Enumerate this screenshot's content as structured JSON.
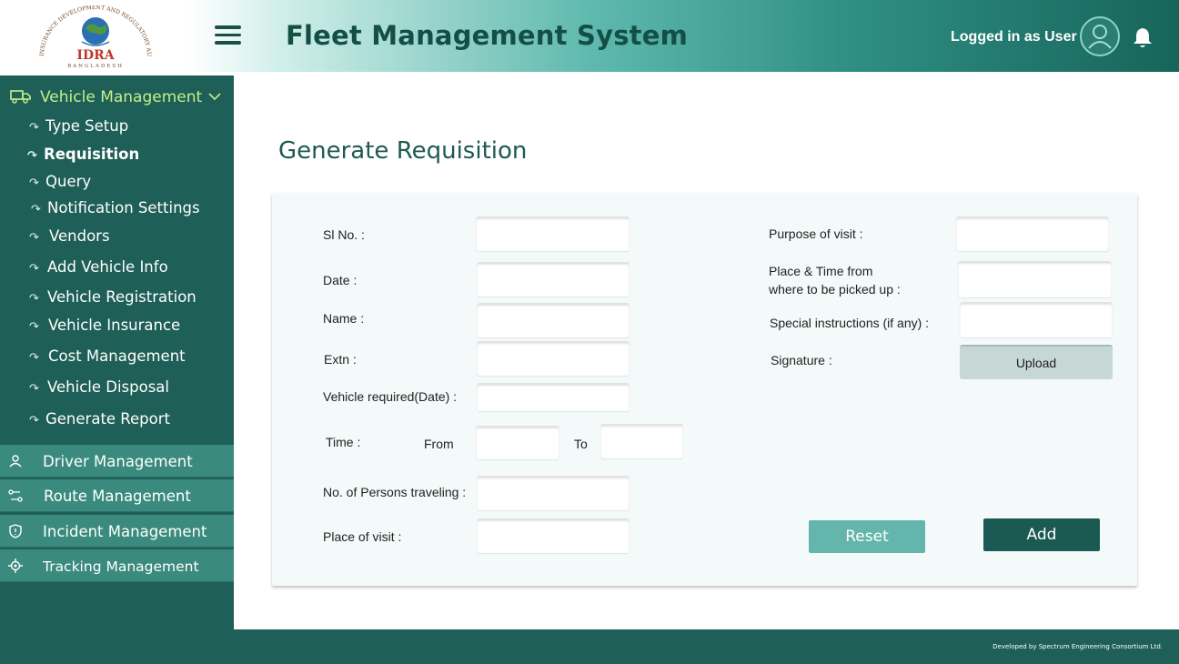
{
  "header": {
    "logo_text": "IDRA",
    "logo_arc_text": "INSURANCE DEVELOPMENT AND REGULATORY AUTHORITY",
    "logo_country": "BANGLADESH",
    "title": "Fleet Management System",
    "user_label": "Logged in as User"
  },
  "sidebar": {
    "section_title": "Vehicle Management",
    "sub_items": [
      {
        "label": "Type Setup"
      },
      {
        "label": "Requisition"
      },
      {
        "label": "Query"
      },
      {
        "label": "Notification Settings"
      },
      {
        "label": "Vendors"
      },
      {
        "label": "Add Vehicle Info"
      },
      {
        "label": "Vehicle Registration"
      },
      {
        "label": "Vehicle Insurance"
      },
      {
        "label": "Cost Management"
      },
      {
        "label": "Vehicle Disposal"
      },
      {
        "label": "Generate Report"
      }
    ],
    "active_item": "Requisition",
    "groups": [
      {
        "label": "Driver Management",
        "icon": "user-icon"
      },
      {
        "label": "Route Management",
        "icon": "route-icon"
      },
      {
        "label": "Incident Management",
        "icon": "shield-icon"
      },
      {
        "label": "Tracking Management",
        "icon": "target-icon"
      }
    ]
  },
  "main": {
    "page_title": "Generate Requisition",
    "form": {
      "sl_no": "Sl No. :",
      "date": "Date :",
      "name": "Name :",
      "extn": "Extn :",
      "vehicle_required": "Vehicle required(Date) :",
      "time": "Time :",
      "from": "From",
      "to": "To",
      "persons": "No. of Persons traveling :",
      "place_of_visit": "Place of visit :",
      "purpose": "Purpose of visit :",
      "pickup_line1": "Place & Time from",
      "pickup_line2": "where to be picked up :",
      "special": "Special instructions (if any) :",
      "signature": "Signature :",
      "upload": "Upload",
      "reset": "Reset",
      "add": "Add"
    }
  },
  "footer": {
    "credit": "Developed by Spectrum Engineering Consortium Ltd."
  },
  "colors": {
    "primary": "#1e5f57",
    "accent_lime": "#c2f08a",
    "reset": "#64b5ac",
    "add": "#1b5a52"
  }
}
